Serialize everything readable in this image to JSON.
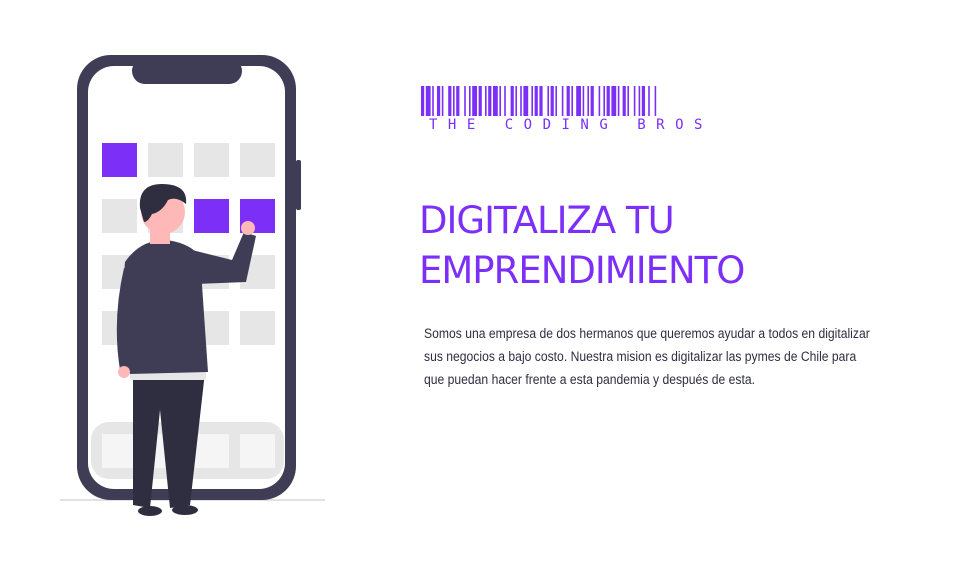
{
  "brand": {
    "logo_text": "THE CODING BROS",
    "accent_color": "#7b2ff7"
  },
  "hero": {
    "title_line1": "DIGITALIZA TU",
    "title_line2": "EMPRENDIMIENTO",
    "description": "Somos una empresa de dos hermanos que queremos ayudar a todos en digitalizar sus negocios a bajo costo. Nuestra mision es digitalizar las pymes de Chile para que puedan hacer frente a esta pandemia y después de esta."
  },
  "illustration": {
    "icon": "person-with-phone-illustration",
    "highlight_color": "#7b2ff7",
    "phone_color": "#3f3d56",
    "tile_color": "#e6e6e6"
  }
}
